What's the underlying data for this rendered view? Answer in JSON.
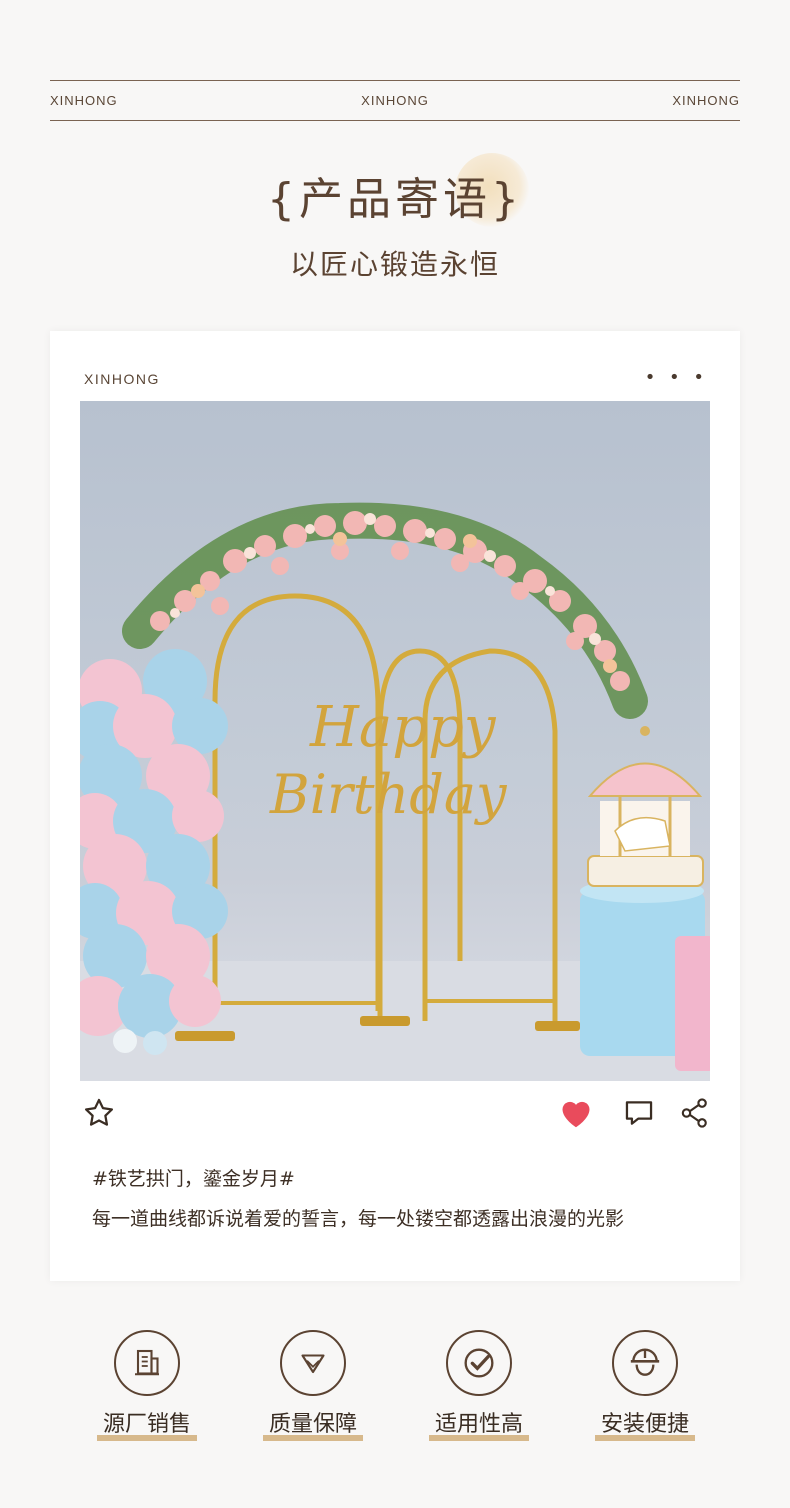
{
  "brand_bar": {
    "left": "XINHONG",
    "center": "XINHONG",
    "right": "XINHONG"
  },
  "header": {
    "title": "{产品寄语}",
    "subtitle": "以匠心锻造永恒"
  },
  "post": {
    "brand": "XINHONG",
    "menu": "• • •",
    "image_text": {
      "line1": "Happy",
      "line2": "Birthday"
    },
    "actions": {
      "liked": true,
      "icons": [
        "star-icon",
        "heart-icon",
        "comment-icon",
        "share-icon"
      ]
    },
    "tag": "#铁艺拱门，鎏金岁月#",
    "description": "每一道曲线都诉说着爱的誓言，每一处镂空都透露出浪漫的光影"
  },
  "features": [
    {
      "icon": "factory-icon",
      "label": "源厂销售"
    },
    {
      "icon": "diamond-icon",
      "label": "质量保障"
    },
    {
      "icon": "check-icon",
      "label": "适用性高"
    },
    {
      "icon": "worker-helmet-icon",
      "label": "安装便捷"
    }
  ],
  "colors": {
    "accent": "#d7b98c",
    "text": "#5b4332",
    "heart": "#e94b5c",
    "gold": "#c9a033"
  }
}
